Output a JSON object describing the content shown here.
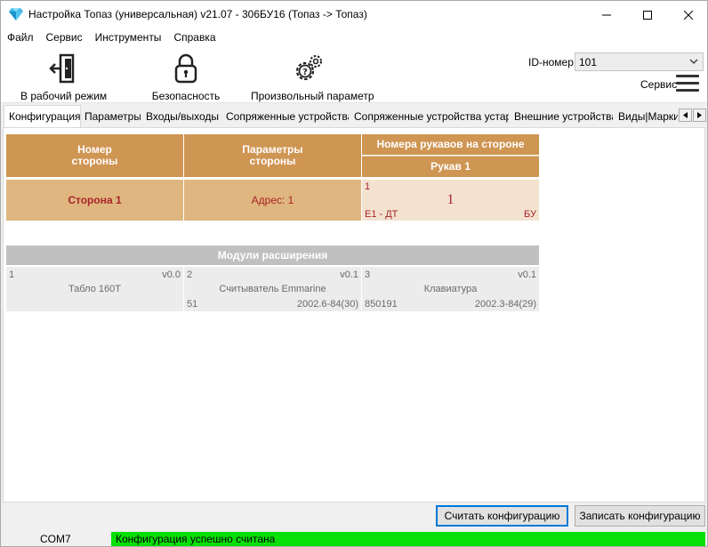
{
  "window": {
    "title": "Настройка Топаз (универсальная) v21.07 - 306БУ16 (Топаз -> Топаз)",
    "icon": "gem-icon"
  },
  "menu": {
    "items": [
      "Файл",
      "Сервис",
      "Инструменты",
      "Справка"
    ]
  },
  "toolbar": {
    "work_mode": {
      "label": "В рабочий режим",
      "icon": "exit-door-icon"
    },
    "security": {
      "label": "Безопасность",
      "icon": "lock-icon"
    },
    "custom_param": {
      "label": "Произвольный параметр",
      "icon": "gears-icon"
    },
    "id_label": "ID-номер",
    "id_value": "101",
    "service_label": "Сервис"
  },
  "tabs": [
    {
      "label": "Конфигурация",
      "active": true
    },
    {
      "label": "Параметры",
      "active": false
    },
    {
      "label": "Входы/выходы",
      "active": false
    },
    {
      "label": "Сопряженные устройства",
      "active": false
    },
    {
      "label": "Сопряженные устройства устар.",
      "active": false
    },
    {
      "label": "Внешние устройства",
      "active": false
    },
    {
      "label": "Виды|Марки",
      "active": false
    }
  ],
  "config": {
    "headers": {
      "side_number": "Номер\nстороны",
      "side_params": "Параметры\nстороны",
      "nozzle_numbers": "Номера рукавов на стороне",
      "nozzle_1": "Рукав 1"
    },
    "sides": [
      {
        "name": "Сторона 1",
        "params": "Адрес: 1",
        "nozzle": {
          "index": "1",
          "number": "1",
          "fuel": "E1 - ДТ",
          "type": "БУ"
        }
      }
    ]
  },
  "modules": {
    "header": "Модули расширения",
    "items": [
      {
        "num": "1",
        "version": "v0.0",
        "name": "Табло 160Т",
        "serial": "",
        "firmware": ""
      },
      {
        "num": "2",
        "version": "v0.1",
        "name": "Считыватель Emmarine",
        "serial": "51",
        "firmware": "2002.6-84(30)"
      },
      {
        "num": "3",
        "version": "v0.1",
        "name": "Клавиатура",
        "serial": "850191",
        "firmware": "2002.3-84(29)"
      }
    ]
  },
  "buttons": {
    "read_config": "Считать конфигурацию",
    "write_config": "Записать конфигурацию"
  },
  "status": {
    "port": "COM7",
    "message": "Конфигурация успешно считана",
    "message_color": "#06e006"
  },
  "colors": {
    "header_bg": "#cf9552",
    "side_bg": "#dfb67f",
    "nozzle_bg": "#f3e2cf",
    "accent_text": "#a8232a",
    "modules_header_bg": "#c0c0c0"
  }
}
